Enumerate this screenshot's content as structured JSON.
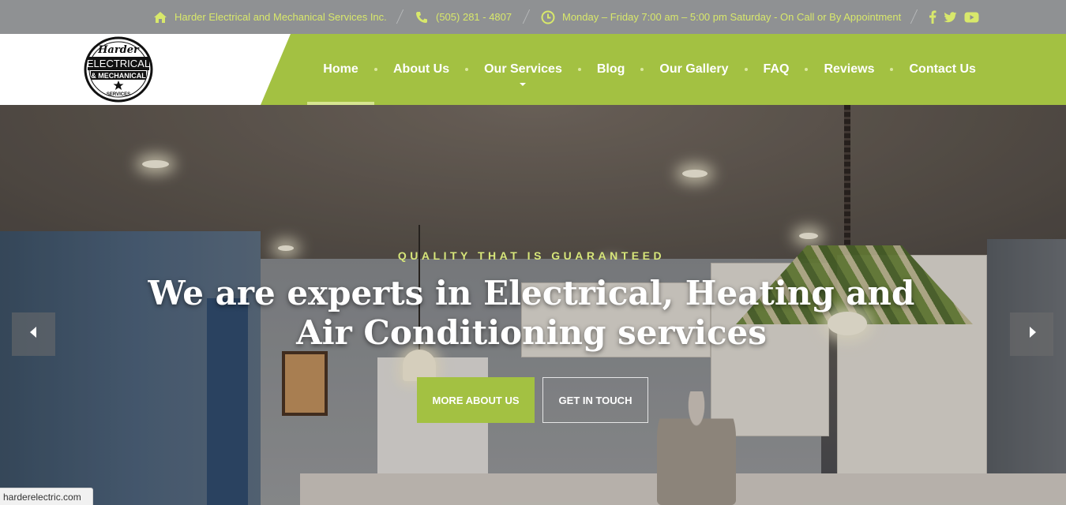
{
  "topbar": {
    "company": "Harder Electrical and Mechanical Services Inc.",
    "phone": "(505) 281 - 4807",
    "hours": "Monday – Friday 7:00 am – 5:00 pm Saturday - On Call or By Appointment",
    "social": [
      "facebook-icon",
      "twitter-icon",
      "youtube-icon"
    ],
    "text_color": "#d8e86b",
    "bg_color": "#8f9193"
  },
  "logo": {
    "script_text": "Harder",
    "line1": "ELECTRICAL",
    "line2": "& MECHANICAL",
    "line3": "SERVICES"
  },
  "nav": {
    "items": [
      {
        "label": "Home",
        "active": true
      },
      {
        "label": "About Us"
      },
      {
        "label": "Our Services",
        "has_dropdown": true
      },
      {
        "label": "Blog"
      },
      {
        "label": "Our Gallery"
      },
      {
        "label": "FAQ"
      },
      {
        "label": "Reviews"
      },
      {
        "label": "Contact Us"
      }
    ],
    "bg_color": "#a3c142"
  },
  "hero": {
    "tagline": "QUALITY THAT IS GUARANTEED",
    "headline": "We are experts in Electrical, Heating and Air Conditioning services",
    "primary_button": "MORE ABOUT US",
    "secondary_button": "GET IN TOUCH",
    "prev_icon": "chevron-left-icon",
    "next_icon": "chevron-right-icon",
    "accent_color": "#a3c142"
  },
  "status_bar": {
    "url": "harderelectric.com"
  }
}
